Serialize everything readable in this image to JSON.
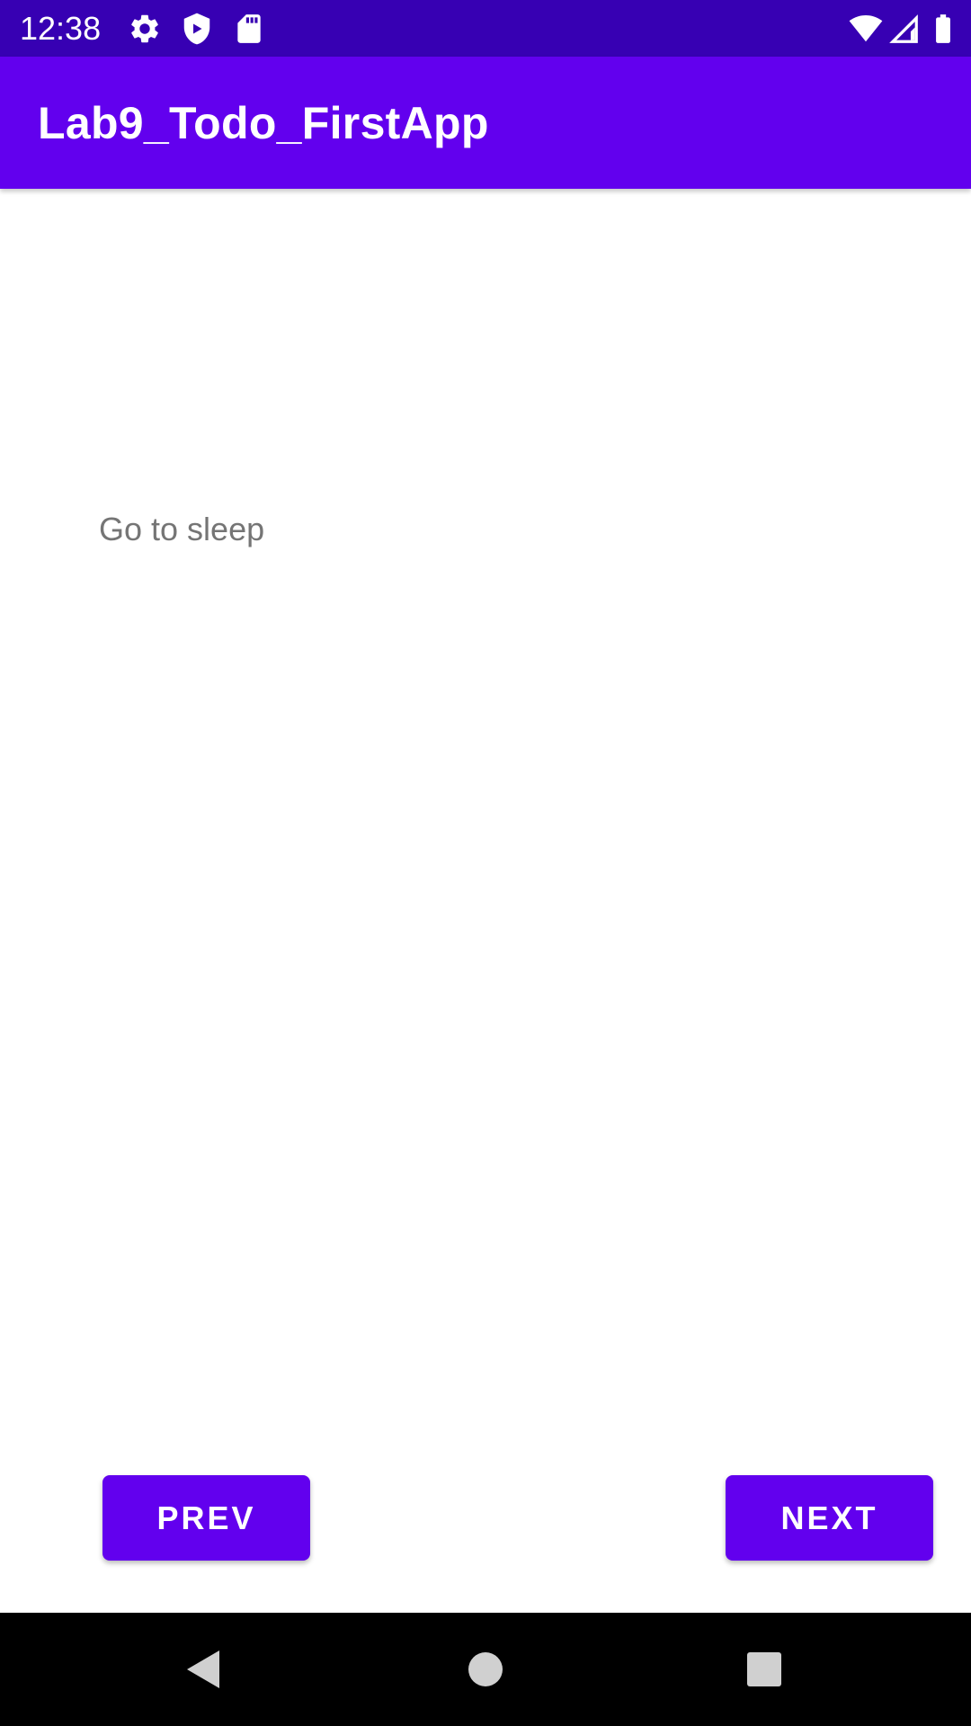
{
  "status_bar": {
    "time": "12:38",
    "icons_left": [
      "gear-icon",
      "shield-icon",
      "sd-card-icon"
    ],
    "icons_right": [
      "wifi-icon",
      "signal-icon",
      "battery-icon"
    ],
    "background_color": "#3700b3"
  },
  "app_bar": {
    "title": "Lab9_Todo_FirstApp",
    "background_color": "#6200ee"
  },
  "content": {
    "todo_text": "Go to sleep"
  },
  "buttons": {
    "prev_label": "PREV",
    "next_label": "NEXT",
    "color": "#6200ee"
  },
  "nav_bar": {
    "icons": [
      "back-icon",
      "home-icon",
      "recents-icon"
    ]
  }
}
